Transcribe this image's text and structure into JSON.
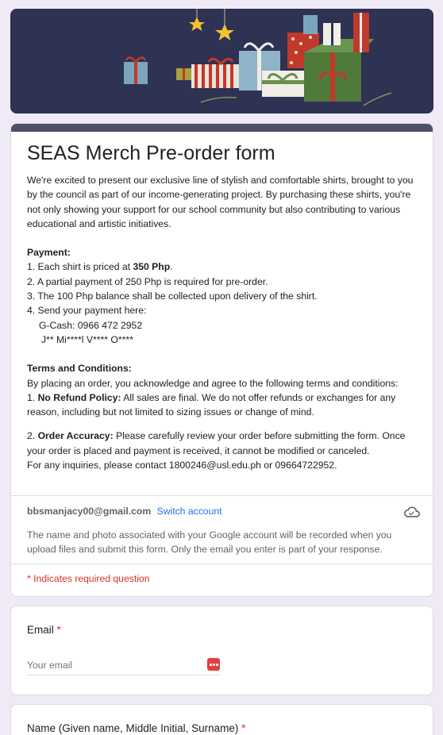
{
  "form": {
    "title": "SEAS Merch Pre-order form",
    "intro": "We're excited to present our exclusive line of stylish and comfortable shirts, brought to you by the council as part of our income-generating project. By purchasing these shirts, you're not only showing your support for our school community but also contributing to various educational and artistic initiatives.",
    "payment": {
      "heading": "Payment:",
      "line1_prefix": "1. Each shirt is priced at ",
      "line1_bold": "350 Php",
      "line1_suffix": ".",
      "line2": "2. A partial payment of 250 Php is required for pre-order.",
      "line3": "3. The 100 Php balance shall be collected upon delivery of the shirt.",
      "line4": "4. Send your payment here:",
      "gcash": "G-Cash: 0966 472 2952",
      "account_name": "J** Mi****l V**** O****"
    },
    "terms": {
      "heading": "Terms and Conditions:",
      "intro": "By placing an order, you acknowledge and agree to the following terms and conditions:",
      "item1_label": "1. ",
      "item1_bold": "No Refund Policy:",
      "item1_text": " All sales are final. We do not offer refunds or exchanges for any reason, including but not limited to sizing issues or change of mind.",
      "item2_label": "2. ",
      "item2_bold": "Order Accuracy:",
      "item2_text": " Please carefully review your order before submitting the form. Once your order is placed and payment is received, it cannot be modified or canceled.",
      "contact": "For any inquiries, please contact 1800246@usl.edu.ph or 09664722952."
    }
  },
  "account": {
    "email": "bbsmanjacy00@gmail.com",
    "switch_label": "Switch account",
    "icon": "cloud-check-icon",
    "note": "The name and photo associated with your Google account will be recorded when you upload files and submit this form. Only the email you enter is part of your response."
  },
  "required_note": "* Indicates required question",
  "questions": {
    "email": {
      "label": "Email",
      "required_mark": "*",
      "placeholder": "Your email",
      "value": ""
    },
    "name": {
      "label": "Name (Given name, Middle Initial, Surname)",
      "required_mark": "*"
    }
  },
  "colors": {
    "background": "#efeaf6",
    "banner": "#2e3253",
    "title_bar": "#4e5068",
    "link": "#1a73e8",
    "required": "#d93025"
  }
}
